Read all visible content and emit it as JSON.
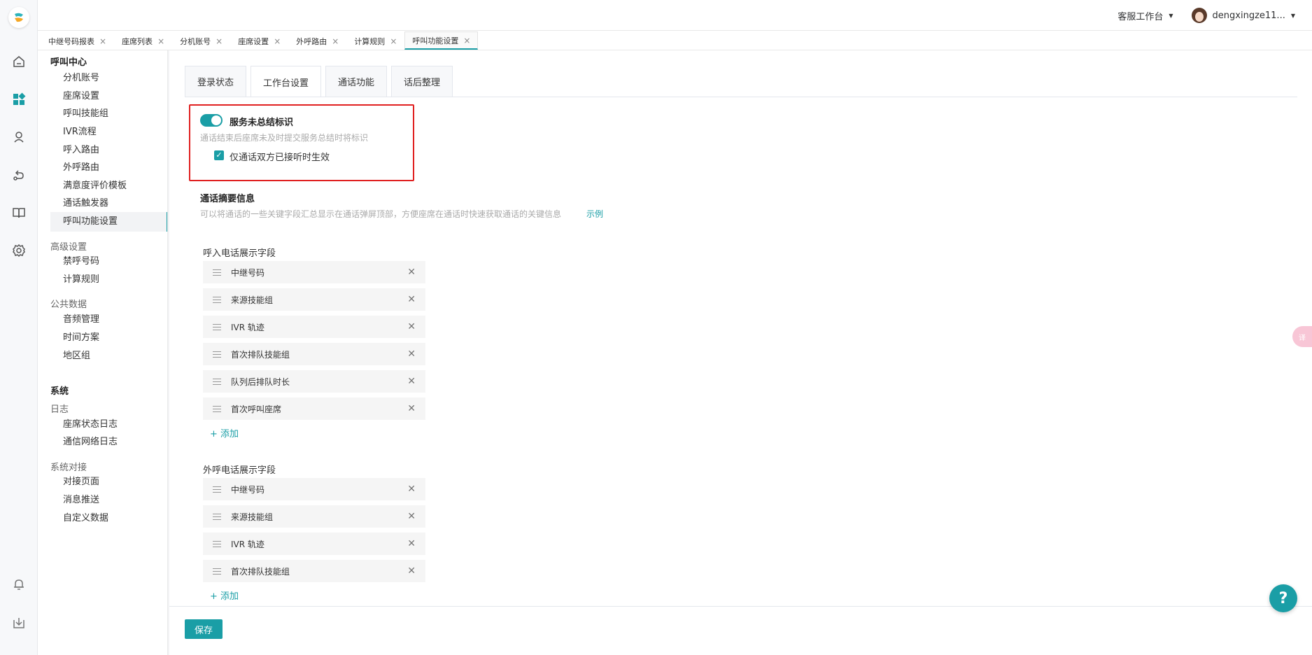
{
  "header": {
    "workspace": "客服工作台",
    "username": "dengxingze11..."
  },
  "tabs": [
    {
      "label": "中继号码报表"
    },
    {
      "label": "座席列表"
    },
    {
      "label": "分机账号"
    },
    {
      "label": "座席设置"
    },
    {
      "label": "外呼路由"
    },
    {
      "label": "计算规则"
    },
    {
      "label": "呼叫功能设置",
      "active": true
    }
  ],
  "sidebar": {
    "group1": "呼叫中心",
    "items1": [
      "分机账号",
      "座席设置",
      "呼叫技能组",
      "IVR流程",
      "呼入路由",
      "外呼路由",
      "满意度评价模板",
      "通话触发器",
      "呼叫功能设置"
    ],
    "sub_advanced": "高级设置",
    "items_advanced": [
      "禁呼号码",
      "计算规则"
    ],
    "sub_public": "公共数据",
    "items_public": [
      "音频管理",
      "时间方案",
      "地区组"
    ],
    "group2": "系统",
    "sub_log": "日志",
    "items_log": [
      "座席状态日志",
      "通信网络日志"
    ],
    "sub_integration": "系统对接",
    "items_integration": [
      "对接页面",
      "消息推送",
      "自定义数据"
    ]
  },
  "subtabs": [
    "登录状态",
    "工作台设置",
    "通话功能",
    "话后整理"
  ],
  "unsummarized": {
    "title": "服务未总结标识",
    "desc": "通话结束后座席未及时提交服务总结时将标识",
    "checkbox_label": "仅通话双方已接听时生效",
    "enabled": true,
    "checked": true
  },
  "summary": {
    "title": "通话摘要信息",
    "desc": "可以将通话的一些关键字段汇总显示在通话弹屏顶部，方便座席在通话时快速获取通话的关键信息",
    "example_link": "示例"
  },
  "inbound": {
    "label": "呼入电话展示字段",
    "fields": [
      "中继号码",
      "来源技能组",
      "IVR 轨迹",
      "首次排队技能组",
      "队列后排队时长",
      "首次呼叫座席"
    ],
    "add": "添加"
  },
  "outbound": {
    "label": "外呼电话展示字段",
    "fields": [
      "中继号码",
      "来源技能组",
      "IVR 轨迹",
      "首次排队技能组"
    ],
    "add": "添加"
  },
  "footer": {
    "save": "保存"
  },
  "colors": {
    "accent": "#1a9ea6",
    "highlight": "#e02020"
  }
}
